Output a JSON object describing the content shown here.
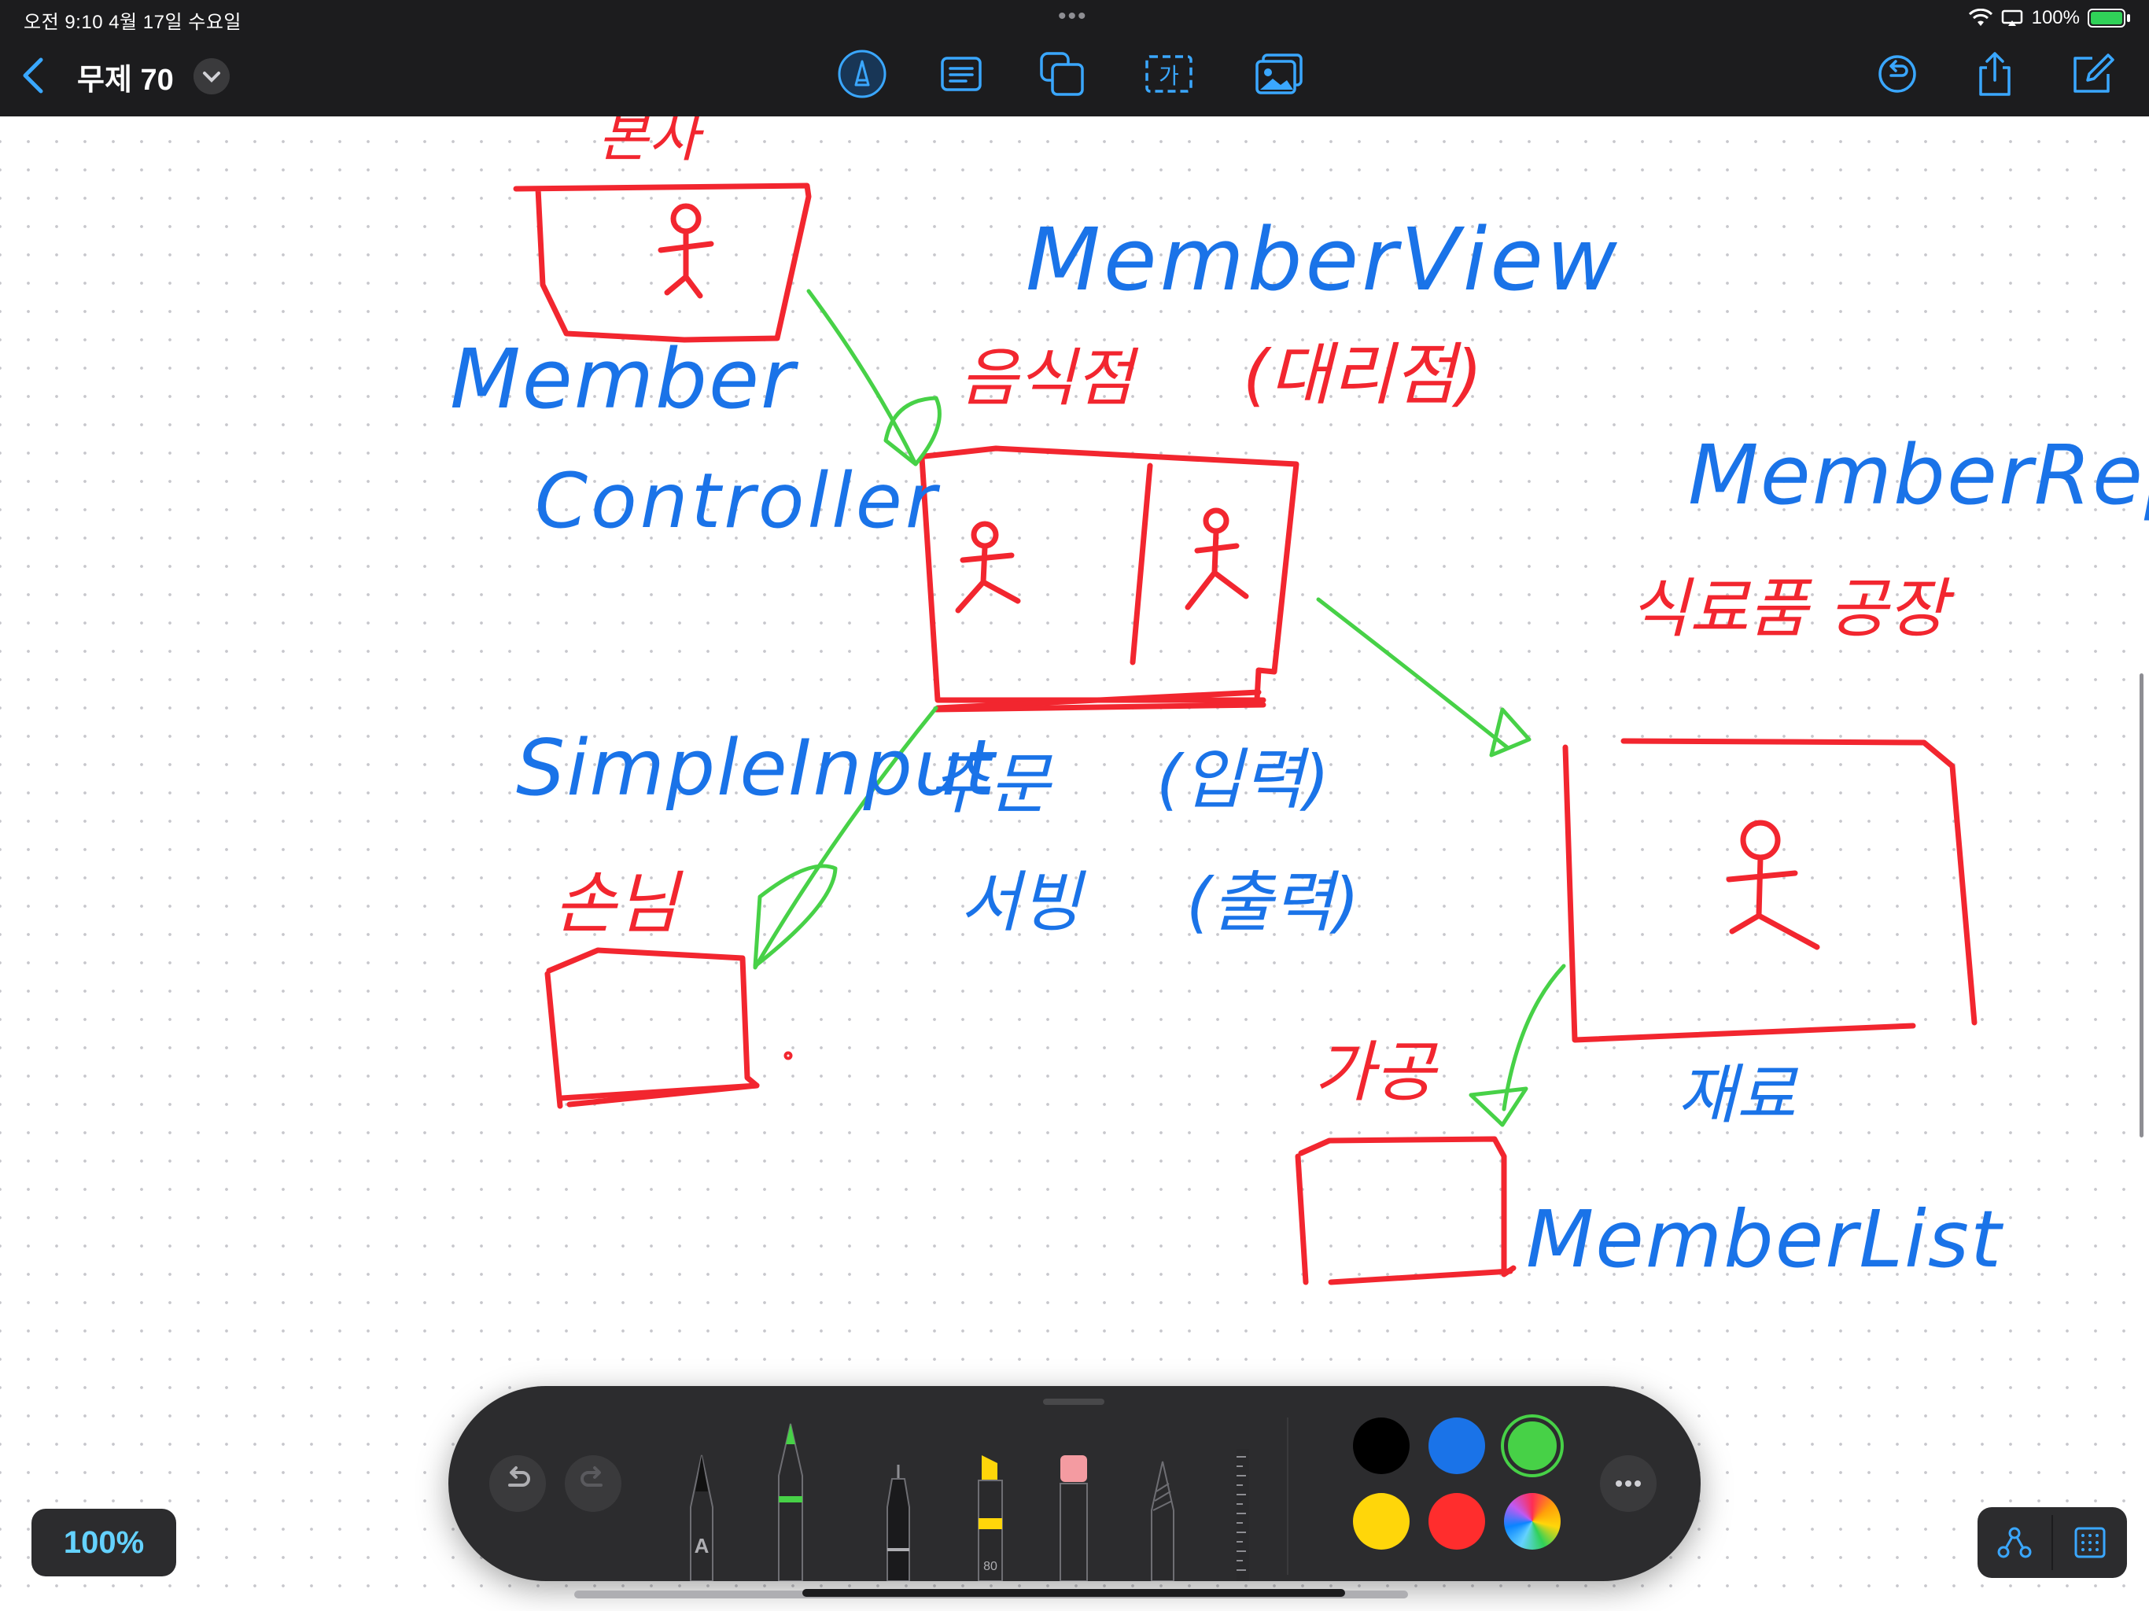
{
  "status": {
    "time_date": "오전 9:10   4월 17일 수요일",
    "battery": "100%"
  },
  "toolbar": {
    "title": "무제 70",
    "tools": [
      "pen-circle-icon",
      "text-box-icon",
      "shapes-icon",
      "text-label-icon",
      "photo-icon"
    ],
    "text_label_glyph": "가",
    "right_actions": [
      "undo-icon",
      "share-icon",
      "compose-icon"
    ]
  },
  "canvas": {
    "handwriting": {
      "top_left_label": "본사",
      "member_view": "MemberView",
      "restaurant": "음식점",
      "restaurant_note": "(대리점)",
      "member_controller_1": "Member",
      "member_controller_2": "Controller",
      "member_repo": "MemberRepo",
      "factory": "식료품 공장",
      "simple_input": "SimpleInput",
      "customer": "손님",
      "order": "주문",
      "order_note": "(입력)",
      "serve": "서빙",
      "serve_note": "(출력)",
      "processing": "가공",
      "ingredients": "재료",
      "member_list": "MemberList"
    },
    "ink_colors": {
      "red": "#f2262f",
      "blue": "#1a73e8",
      "green": "#47d147"
    }
  },
  "palette": {
    "undo": "undo-icon",
    "redo": "redo-icon",
    "tools": [
      "monoline-pen",
      "marker",
      "fineliner",
      "highlighter",
      "eraser",
      "crayon",
      "ruler"
    ],
    "pen_label": "A",
    "highlighter_size": "80",
    "colors": [
      "#000000",
      "#1a73e8",
      "#47d147",
      "#ffd60a",
      "#ff2d2d",
      "color-wheel"
    ],
    "selected_color": "#47d147",
    "more": "more-icon"
  },
  "zoom": "100%"
}
